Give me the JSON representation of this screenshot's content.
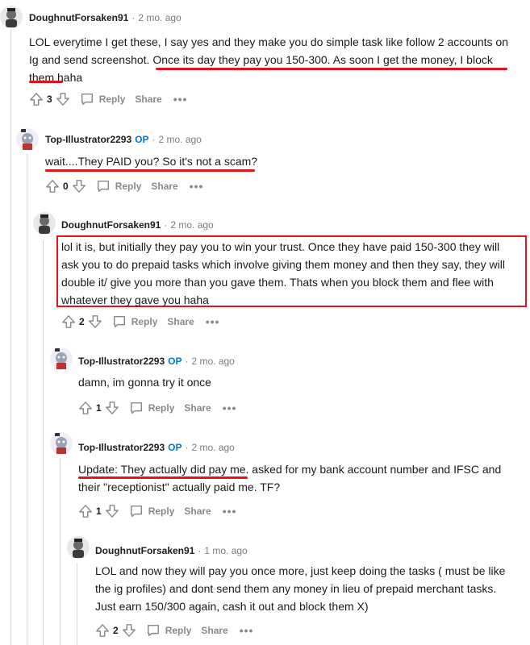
{
  "colors": {
    "accent_op": "#0079d3",
    "annotation_red": "#e0141b",
    "thread_line": "#d4d6d8"
  },
  "labels": {
    "reply": "Reply",
    "share": "Share",
    "op": "OP",
    "more": "•••"
  },
  "comments": [
    {
      "user": "DoughnutForsaken91",
      "op": false,
      "age": "2 mo. ago",
      "lines": [
        "LOL everytime I get these, I say yes and they make you do simple task like follow 2 accounts on",
        "Ig and send screenshot. Once its day they pay you 150-300. As soon I get the money, I block",
        "them haha"
      ],
      "votes": "3"
    },
    {
      "user": "Top-Illustrator2293",
      "op": true,
      "age": "2 mo. ago",
      "lines": [
        "wait....They PAID you? So it's not a scam?"
      ],
      "votes": "0"
    },
    {
      "user": "DoughnutForsaken91",
      "op": false,
      "age": "2 mo. ago",
      "lines": [
        "lol it is, but initially they pay you to win your trust. Once they have paid 150-300 they will",
        "ask you to do prepaid tasks which involve giving them money and then they say, they will",
        "double it/ give you more than you gave them. Thats when you block them and flee with",
        "whatever they gave you haha"
      ],
      "votes": "2"
    },
    {
      "user": "Top-Illustrator2293",
      "op": true,
      "age": "2 mo. ago",
      "lines": [
        "damn, im gonna try it once"
      ],
      "votes": "1"
    },
    {
      "user": "Top-Illustrator2293",
      "op": true,
      "age": "2 mo. ago",
      "lines": [
        "Update: They actually did pay me. asked for my bank account number and IFSC and",
        "their \"receptionist\" actually paid me. TF?"
      ],
      "votes": "1"
    },
    {
      "user": "DoughnutForsaken91",
      "op": false,
      "age": "1 mo. ago",
      "lines": [
        "LOL and now they will pay you once more, just keep doing the tasks ( must be like",
        "the ig profiles) and dont send them any money in lieu of prepaid merchant tasks.",
        "Just earn 150/300 again, cash it out and block them X)"
      ],
      "votes": "2"
    }
  ]
}
